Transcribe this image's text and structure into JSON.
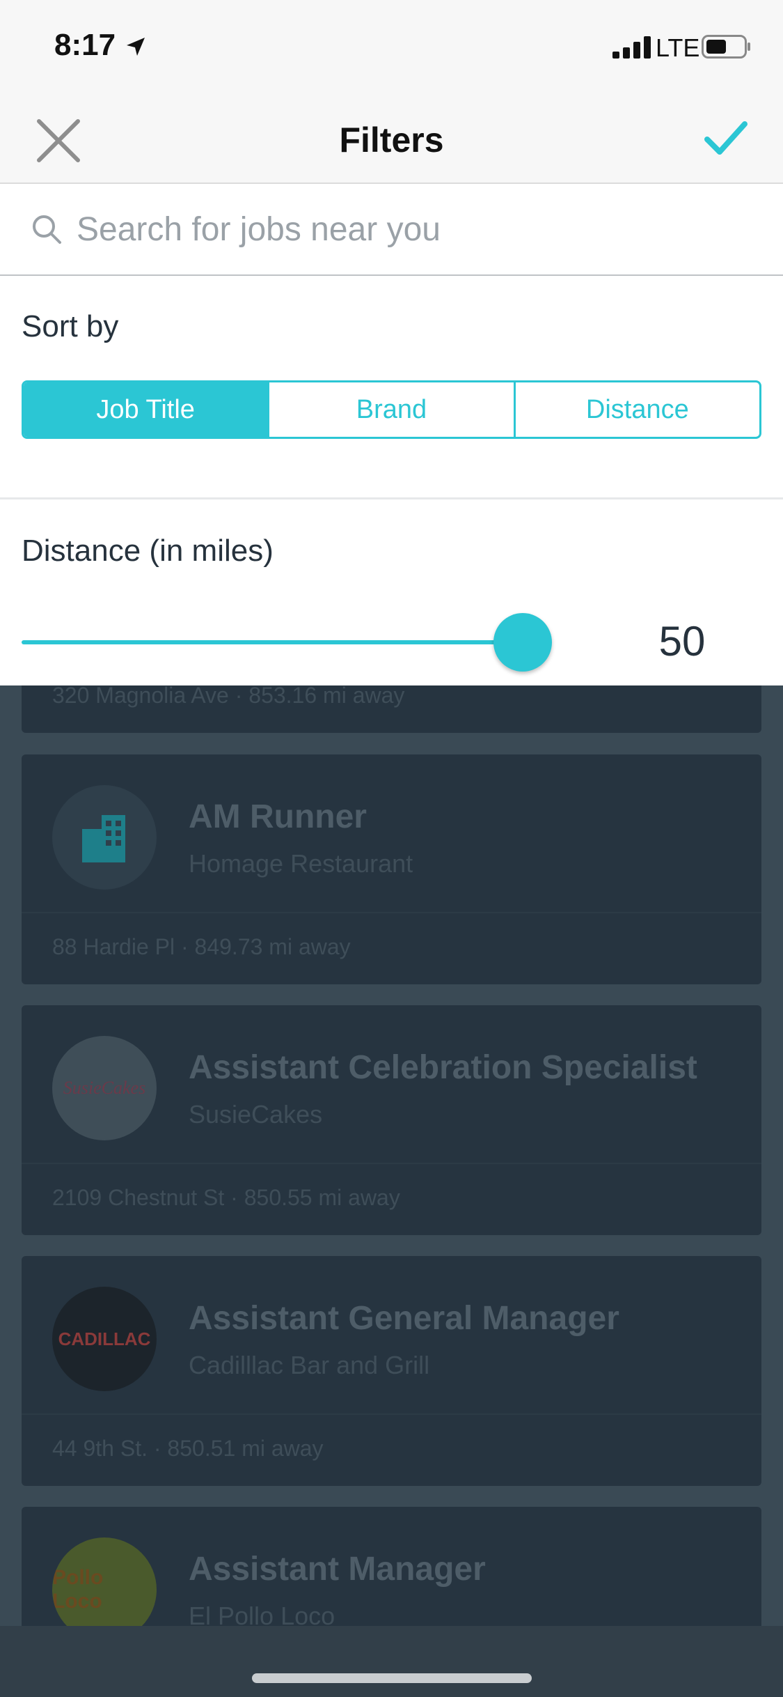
{
  "status_bar": {
    "time": "8:17",
    "carrier": "LTE"
  },
  "header": {
    "title": "Filters"
  },
  "search": {
    "placeholder": "Search for jobs near you",
    "value": ""
  },
  "sort": {
    "label": "Sort by",
    "options": [
      "Job Title",
      "Brand",
      "Distance"
    ],
    "selected": "Job Title"
  },
  "distance": {
    "label": "Distance (in miles)",
    "value": "50",
    "slider_fraction": 0.93
  },
  "background_jobs": {
    "peek_address": "320 Magnolia Ave · 853.16 mi away",
    "items": [
      {
        "title": "AM Runner",
        "brand": "Homage Restaurant",
        "address": "88 Hardie Pl · 849.73 mi away",
        "logo": "building-icon"
      },
      {
        "title": "Assistant Celebration Specialist",
        "brand": "SusieCakes",
        "address": "2109 Chestnut St · 850.55 mi away",
        "logo": "SusieCakes"
      },
      {
        "title": "Assistant General Manager",
        "brand": "Cadilllac Bar and Grill",
        "address": "44 9th St. · 850.51 mi away",
        "logo": "CADILLAC"
      },
      {
        "title": "Assistant Manager",
        "brand": "El Pollo Loco",
        "address": "",
        "logo": "Pollo Loco"
      }
    ]
  },
  "colors": {
    "accent": "#2bc6d4",
    "sheet": "#ffffff",
    "overlay": "#263440"
  }
}
